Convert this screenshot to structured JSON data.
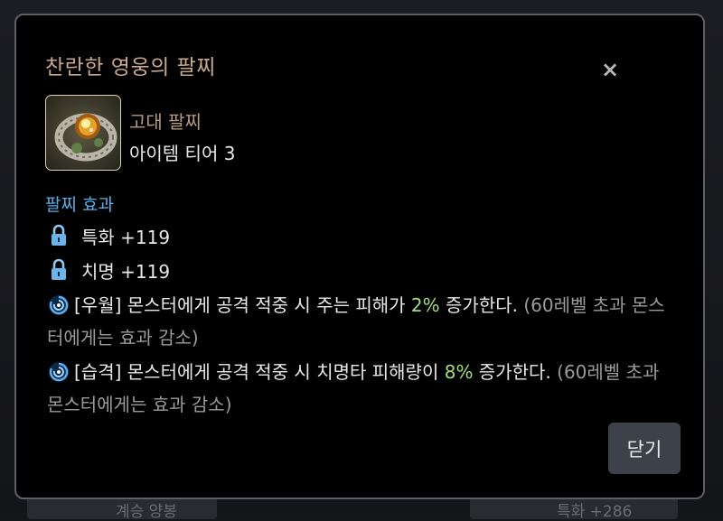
{
  "background": {
    "left_card_text": "계승 양봉",
    "right_card_text": "특화 +286"
  },
  "modal": {
    "title": "찬란한 영웅의 팔찌",
    "close_glyph": "×",
    "item": {
      "icon": "bracelet-item-icon",
      "grade": "고대 팔찌",
      "tier": "아이템 티어 3"
    },
    "effects_title": "팔찌 효과",
    "stats": [
      {
        "icon": "lock-icon",
        "text": "특화 +119"
      },
      {
        "icon": "lock-icon",
        "text": "치명 +119"
      }
    ],
    "special_effects": [
      {
        "icon": "swirl-icon",
        "prefix": "[우월] 몬스터에게 공격 적중 시 주는 피해가 ",
        "value": "2%",
        "suffix": " 증가한다. ",
        "note": "(60레벨 초과 몬스터에게는 효과 감소)"
      },
      {
        "icon": "swirl-icon",
        "prefix": "[습격] 몬스터에게 공격 적중 시 치명타 피해량이 ",
        "value": "8%",
        "suffix": " 증가한다. ",
        "note": "(60레벨 초과 몬스터에게는 효과 감소)"
      }
    ],
    "confirm_label": "닫기"
  },
  "colors": {
    "title": "#c9a78b",
    "section": "#58aee8",
    "highlight": "#9fe07d",
    "note": "#9a9a9a",
    "button_bg": "#3d4149"
  }
}
